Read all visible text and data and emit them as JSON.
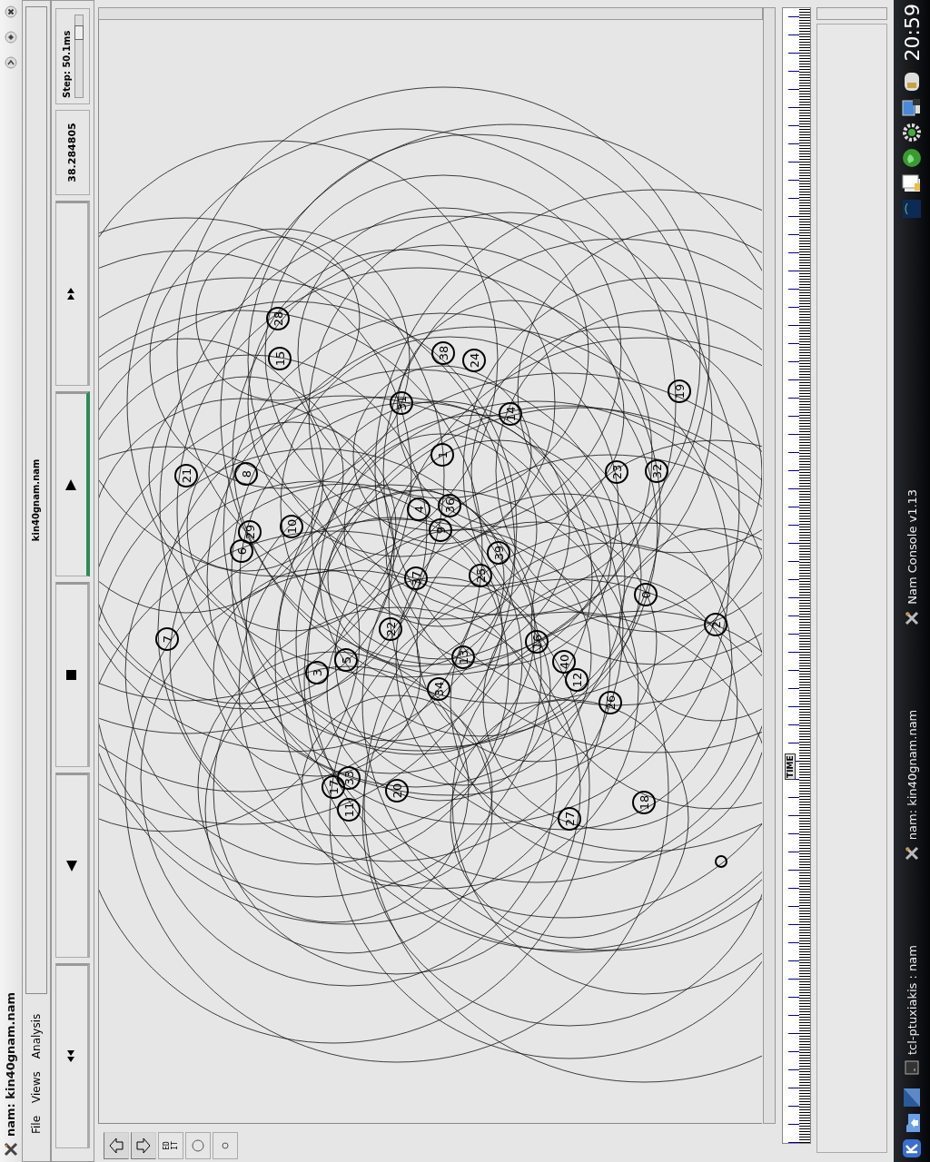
{
  "window": {
    "title": "nam: kin40gnam.nam"
  },
  "menus": [
    "File",
    "Views",
    "Analysis"
  ],
  "file_label": "kin40gnam.nam",
  "playback": {
    "buttons": [
      {
        "kind": "rewind",
        "selected": false
      },
      {
        "kind": "back",
        "selected": false
      },
      {
        "kind": "stop",
        "selected": false
      },
      {
        "kind": "play",
        "selected": true
      },
      {
        "kind": "fast_forward",
        "selected": false
      }
    ],
    "time": "38.284805",
    "step": "Step: 50.1ms",
    "step_slider": {
      "level": 0.85
    }
  },
  "tools": [
    {
      "kind": "left"
    },
    {
      "kind": "right"
    },
    {
      "kind": "edit",
      "label": "ED IT"
    },
    {
      "kind": "circle"
    },
    {
      "kind": "dot"
    }
  ],
  "network": {
    "nodes": [
      {
        "label": "28"
      },
      {
        "label": "15"
      },
      {
        "label": "38"
      },
      {
        "label": "24"
      },
      {
        "label": "31"
      },
      {
        "label": "14"
      },
      {
        "label": "19"
      },
      {
        "label": "1"
      },
      {
        "label": "21"
      },
      {
        "label": "8"
      },
      {
        "label": "23"
      },
      {
        "label": "32"
      },
      {
        "label": "4"
      },
      {
        "label": "36"
      },
      {
        "label": "9"
      },
      {
        "label": "29"
      },
      {
        "label": "10"
      },
      {
        "label": "6"
      },
      {
        "label": "39"
      },
      {
        "label": "25"
      },
      {
        "label": "37"
      },
      {
        "label": "0"
      },
      {
        "label": "2"
      },
      {
        "label": "22"
      },
      {
        "label": "7"
      },
      {
        "label": "16"
      },
      {
        "label": "40"
      },
      {
        "label": "13"
      },
      {
        "label": "5"
      },
      {
        "label": "3"
      },
      {
        "label": "12"
      },
      {
        "label": "34"
      },
      {
        "label": "26"
      },
      {
        "label": "33"
      },
      {
        "label": "17"
      },
      {
        "label": "20"
      },
      {
        "label": "11"
      },
      {
        "label": "18"
      },
      {
        "label": "27"
      }
    ]
  },
  "timeline": {
    "marker": "TIME"
  },
  "taskbar": {
    "tasks": [
      {
        "kind": "terminal",
        "label": "tcl-ptuxiakis : nam"
      },
      {
        "kind": "app",
        "label": "nam: kin40gnam.nam"
      },
      {
        "kind": "app",
        "label": "Nam Console v1.13"
      }
    ],
    "clock": "20:59"
  }
}
